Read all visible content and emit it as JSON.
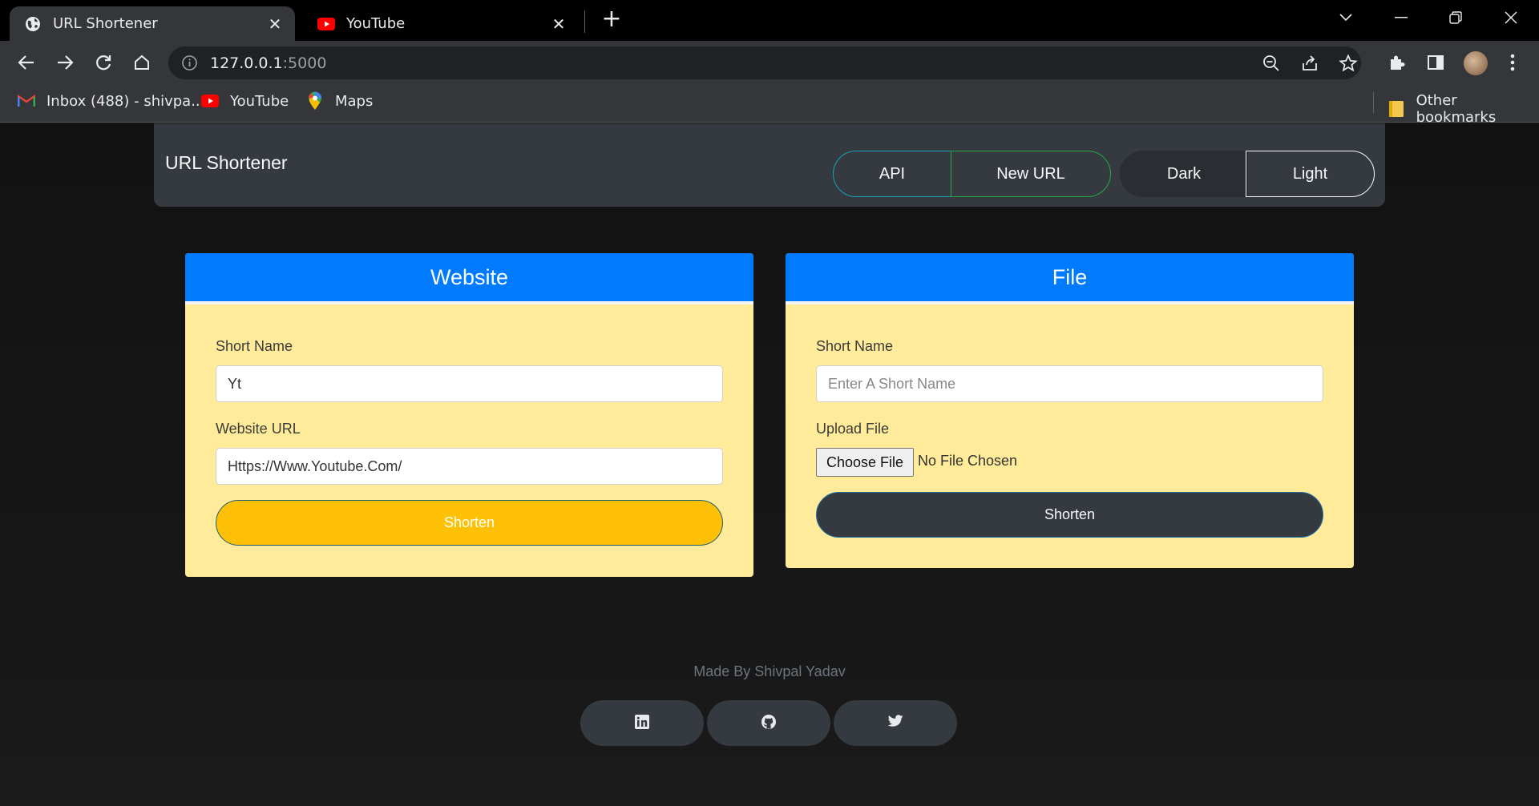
{
  "browser": {
    "tabs": [
      {
        "title": "URL Shortener",
        "favicon": "globe-icon",
        "active": true
      },
      {
        "title": "YouTube",
        "favicon": "youtube-icon",
        "active": false
      }
    ],
    "address": {
      "host": "127.0.0.1",
      "port": ":5000"
    },
    "bookmarks": [
      {
        "label": "Inbox (488) - shivpa...",
        "icon": "gmail-icon"
      },
      {
        "label": "YouTube",
        "icon": "youtube-icon"
      },
      {
        "label": "Maps",
        "icon": "maps-icon"
      }
    ],
    "other_bookmarks": "Other bookmarks"
  },
  "navbar": {
    "brand": "URL Shortener",
    "buttons": {
      "api": "API",
      "new_url": "New URL",
      "dark": "Dark",
      "light": "Light"
    }
  },
  "website_card": {
    "header": "Website",
    "short_name_label": "Short Name",
    "short_name_value": "Yt",
    "url_label": "Website URL",
    "url_value": "Https://Www.Youtube.Com/",
    "submit": "Shorten"
  },
  "file_card": {
    "header": "File",
    "short_name_label": "Short Name",
    "short_name_placeholder": "Enter A Short Name",
    "upload_label": "Upload File",
    "choose_button": "Choose File",
    "no_file": "No File Chosen",
    "submit": "Shorten"
  },
  "footer": {
    "credit": "Made By Shivpal Yadav",
    "social": [
      "linkedin-icon",
      "github-icon",
      "twitter-icon"
    ]
  },
  "colors": {
    "card_header": "#007bff",
    "card_body": "#ffeb99",
    "accent_yellow": "#ffc107",
    "navbar": "#343a40"
  }
}
